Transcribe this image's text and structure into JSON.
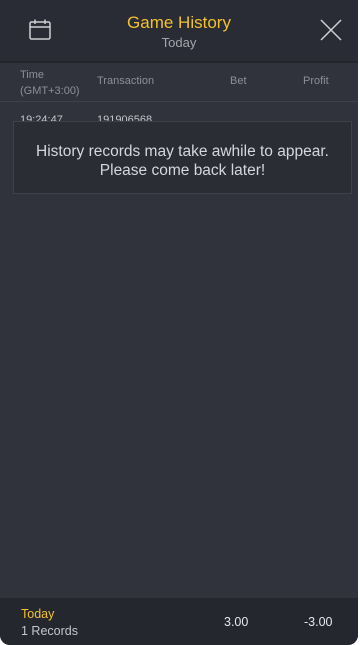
{
  "header": {
    "title": "Game History",
    "subtitle": "Today",
    "calendar_icon": "calendar-icon",
    "close_icon": "close-icon"
  },
  "table": {
    "columns": {
      "time": "Time",
      "timezone": "(GMT+3:00)",
      "transaction": "Transaction",
      "bet": "Bet",
      "profit": "Profit"
    },
    "rows": [
      {
        "time": "19:24:47",
        "transaction": "191906568"
      }
    ]
  },
  "notice": {
    "line1": "History records may take awhile to appear.",
    "line2": "Please come back later!"
  },
  "footer": {
    "period": "Today",
    "records": "1 Records",
    "bet_total": "3.00",
    "profit_total": "-3.00"
  },
  "colors": {
    "accent": "#f2c12e",
    "background": "#30323c",
    "header": "#2a2c35",
    "footer": "#25272f"
  }
}
